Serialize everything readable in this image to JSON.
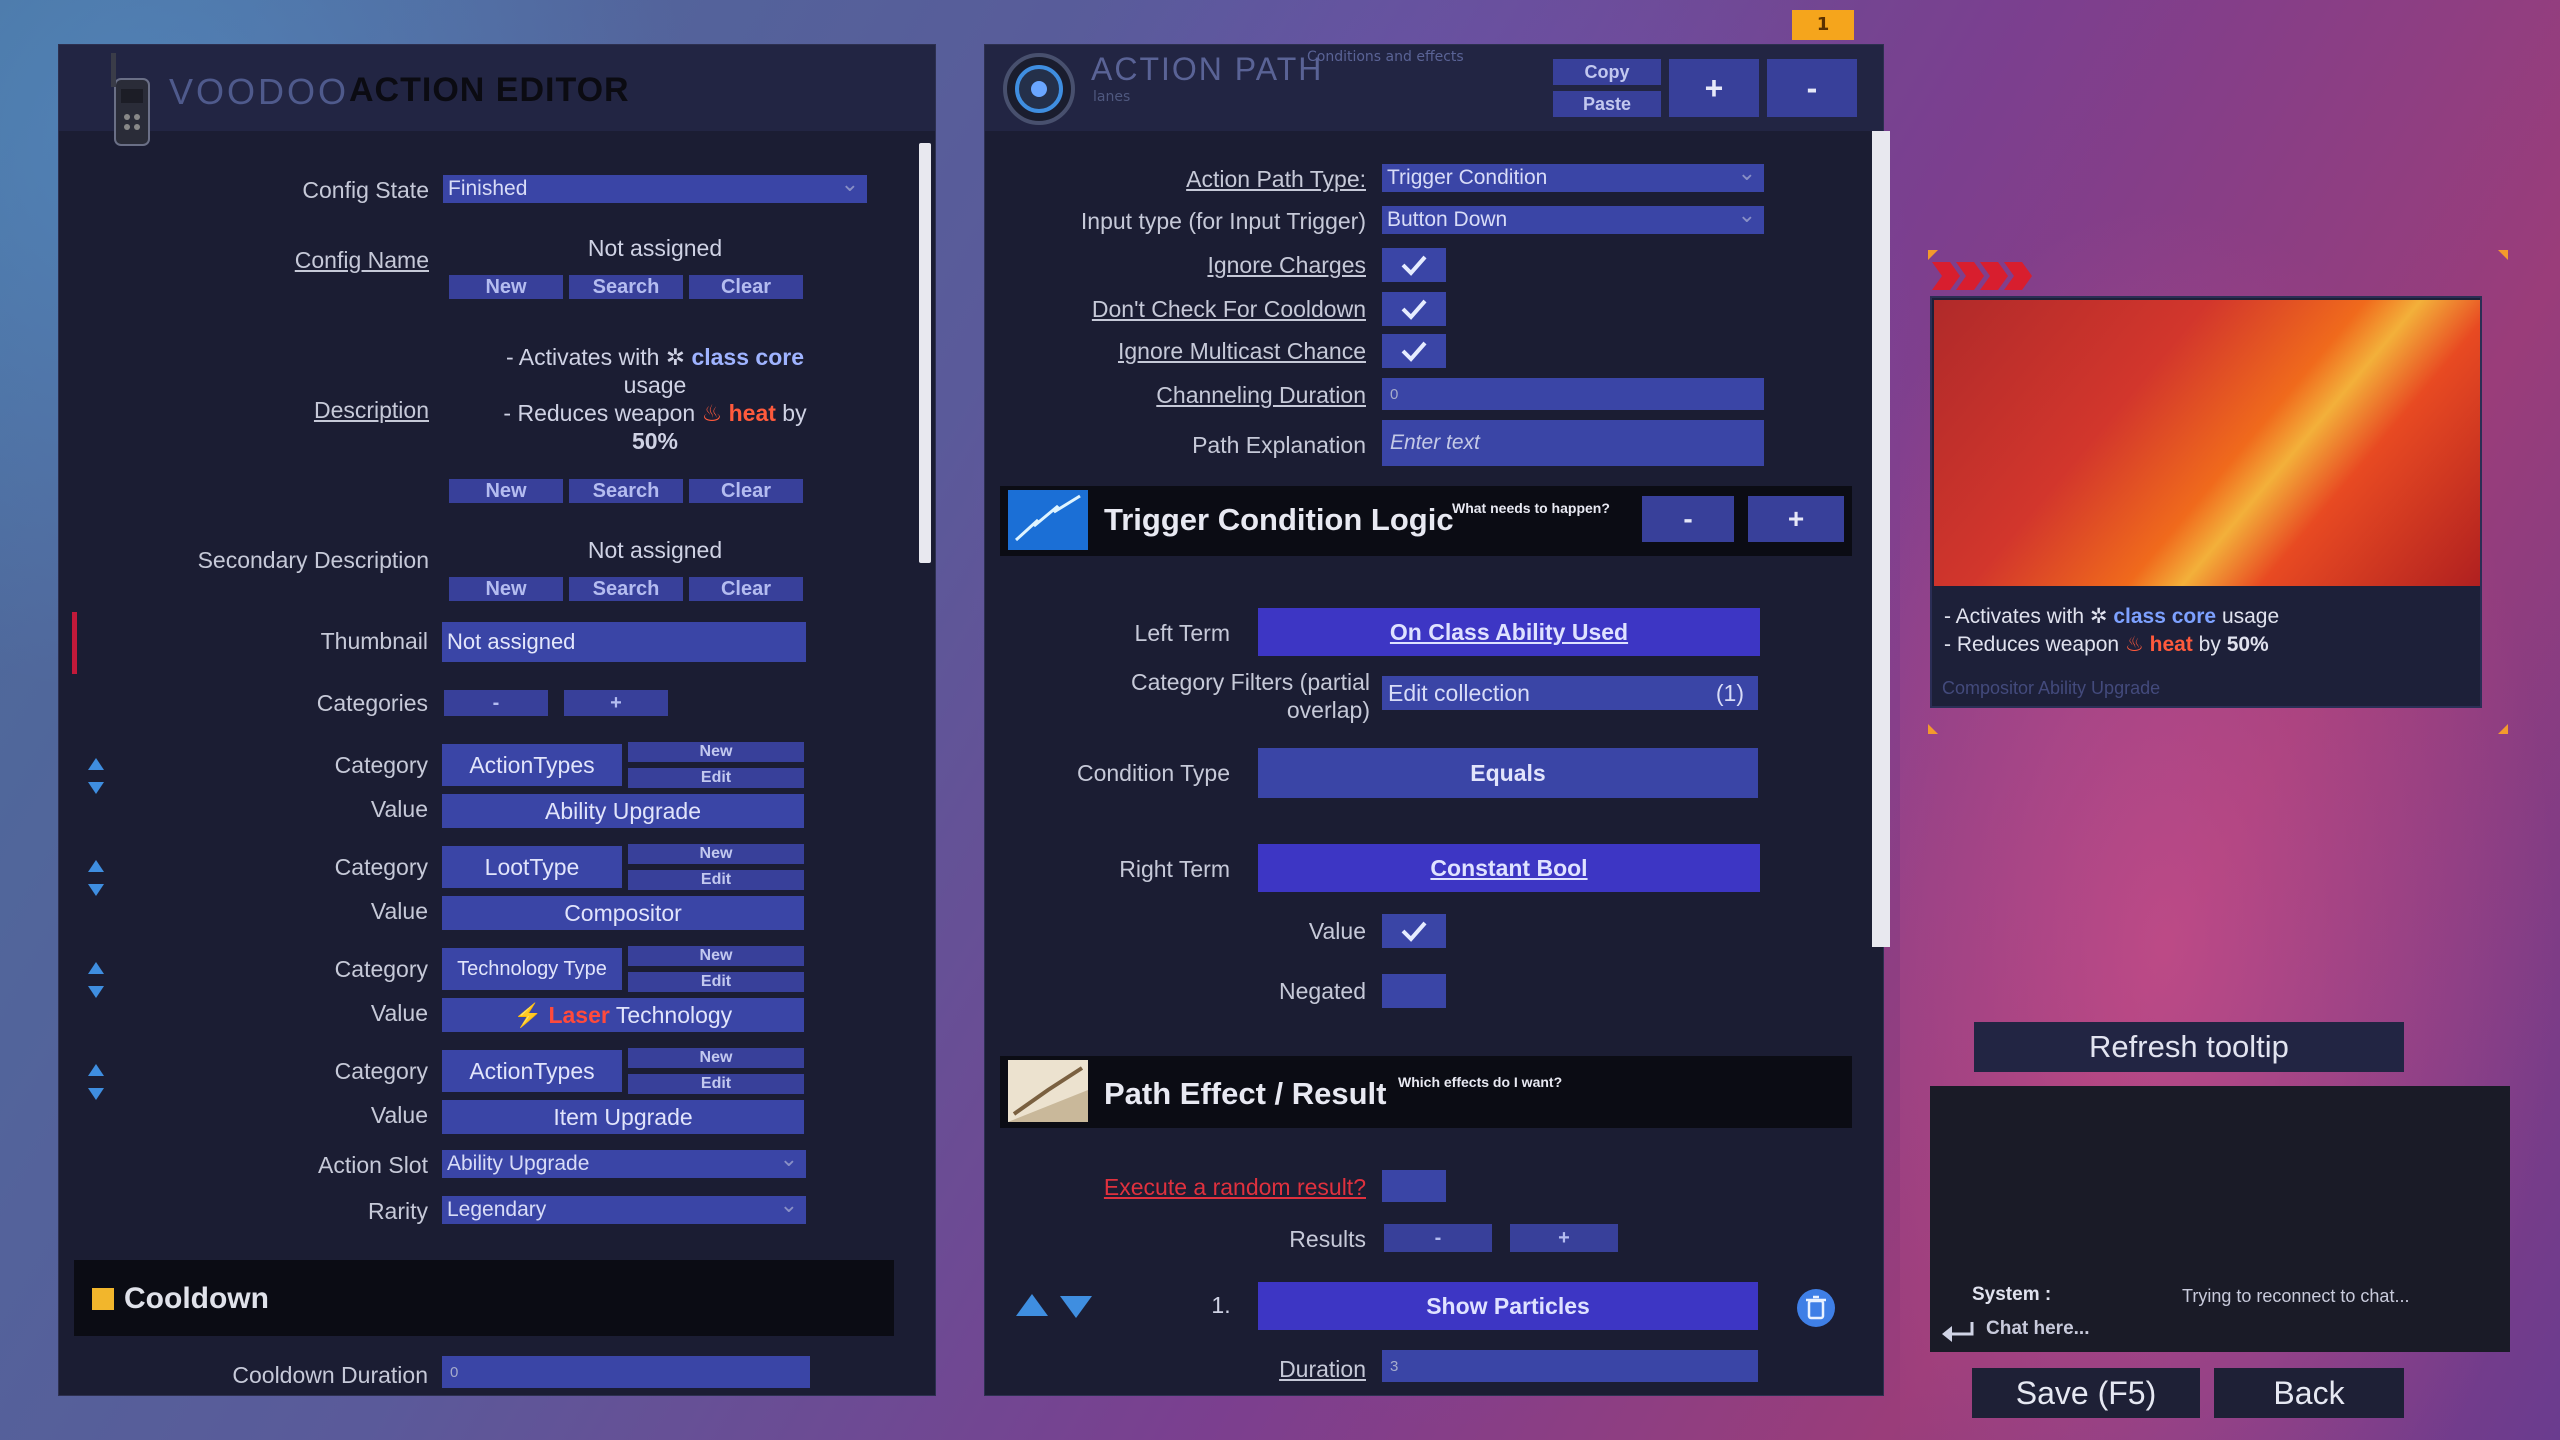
{
  "top_badge": "1",
  "left_panel": {
    "brand": "VOODOO",
    "title": "ACTION EDITOR",
    "config_state": {
      "label": "Config State",
      "value": "Finished"
    },
    "config_name": {
      "label": "Config Name",
      "value": "Not assigned",
      "buttons": [
        "New",
        "Search",
        "Clear"
      ]
    },
    "description": {
      "label": "Description",
      "line1_prefix": "- Activates with",
      "line1_keyword": "class core",
      "line1_suffix": "usage",
      "line2_prefix": "- Reduces weapon",
      "line2_keyword": "heat",
      "line2_suffix": "by",
      "line3": "50%",
      "buttons": [
        "New",
        "Search",
        "Clear"
      ]
    },
    "secondary_description": {
      "label": "Secondary Description",
      "value": "Not assigned",
      "buttons": [
        "New",
        "Search",
        "Clear"
      ]
    },
    "thumbnail": {
      "label": "Thumbnail",
      "value": "Not assigned"
    },
    "categories": {
      "label": "Categories",
      "minus": "-",
      "plus": "+"
    },
    "category_rows": [
      {
        "category_label": "Category",
        "category": "ActionTypes",
        "value_label": "Value",
        "value": "Ability Upgrade",
        "new": "New",
        "edit": "Edit"
      },
      {
        "category_label": "Category",
        "category": "LootType",
        "value_label": "Value",
        "value": "Compositor",
        "new": "New",
        "edit": "Edit"
      },
      {
        "category_label": "Category",
        "category": "Technology Type",
        "value_label": "Value",
        "value_keyword": "Laser",
        "value": "Technology",
        "new": "New",
        "edit": "Edit"
      },
      {
        "category_label": "Category",
        "category": "ActionTypes",
        "value_label": "Value",
        "value": "Item Upgrade",
        "new": "New",
        "edit": "Edit"
      }
    ],
    "action_slot": {
      "label": "Action Slot",
      "value": "Ability Upgrade"
    },
    "rarity": {
      "label": "Rarity",
      "value": "Legendary"
    },
    "cooldown_title": "Cooldown",
    "cooldown_duration": {
      "label": "Cooldown Duration",
      "value": "0"
    }
  },
  "middle_panel": {
    "title": "ACTION PATH",
    "subtitle": "Conditions and effects",
    "sub2": "lanes",
    "copy": "Copy",
    "paste": "Paste",
    "plus": "+",
    "minus": "-",
    "action_path_type": {
      "label": "Action Path Type:",
      "value": "Trigger Condition"
    },
    "input_type": {
      "label": "Input type (for Input Trigger)",
      "value": "Button Down"
    },
    "ignore_charges": {
      "label": "Ignore Charges",
      "checked": true
    },
    "dont_check_cooldown": {
      "label": "Don't Check For Cooldown",
      "checked": true
    },
    "ignore_multicast": {
      "label": "Ignore Multicast Chance",
      "checked": true
    },
    "channeling_duration": {
      "label": "Channeling Duration",
      "value": "0"
    },
    "path_explanation": {
      "label": "Path Explanation",
      "placeholder": "Enter text"
    },
    "trigger_section": {
      "title": "Trigger Condition Logic",
      "subtitle": "What needs to happen?",
      "minus": "-",
      "plus": "+"
    },
    "left_term": {
      "label": "Left Term",
      "value": "On Class Ability Used"
    },
    "category_filters": {
      "label_line1": "Category Filters (partial",
      "label_line2": "overlap)",
      "value": "Edit collection",
      "count": "(1)"
    },
    "condition_type": {
      "label": "Condition Type",
      "value": "Equals"
    },
    "right_term": {
      "label": "Right Term",
      "value": "Constant Bool"
    },
    "value_field": {
      "label": "Value",
      "checked": true
    },
    "negated": {
      "label": "Negated",
      "checked": false
    },
    "effect_section": {
      "title": "Path Effect / Result",
      "subtitle": "Which effects do I want?"
    },
    "random_result": {
      "label": "Execute a random result?",
      "checked": false
    },
    "results": {
      "label": "Results",
      "minus": "-",
      "plus": "+"
    },
    "result_items": [
      {
        "index": "1.",
        "name": "Show Particles"
      }
    ],
    "duration": {
      "label": "Duration",
      "value": "3"
    }
  },
  "tooltip": {
    "line1_prefix": "- Activates with",
    "line1_keyword": "class core",
    "line1_suffix": "usage",
    "line2_prefix": "- Reduces weapon",
    "line2_keyword": "heat",
    "line2_suffix": "by",
    "line2_value": "50%",
    "footer": "Compositor Ability Upgrade"
  },
  "refresh_tooltip": "Refresh tooltip",
  "chat": {
    "sender": "System :",
    "message": "Trying to reconnect to chat...",
    "input_placeholder": "Chat here..."
  },
  "save_button": "Save (F5)",
  "back_button": "Back",
  "colors": {
    "accent": "#3a45a6",
    "highlight_core": "#7da1ff",
    "highlight_heat": "#ff5a3c",
    "cooldown_marker": "#f2b62c"
  }
}
